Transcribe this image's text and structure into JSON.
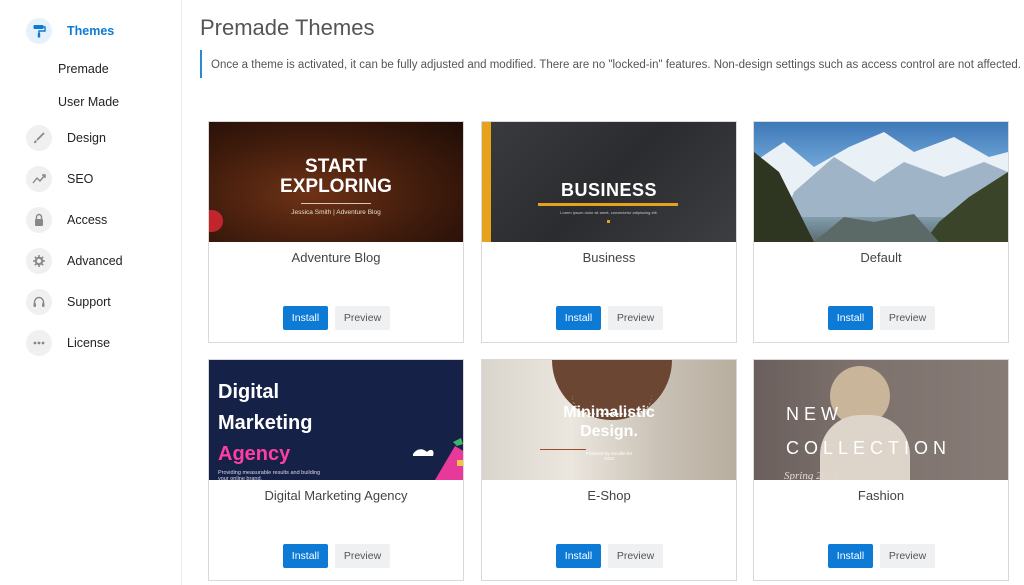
{
  "sidebar": {
    "themes_label": "Themes",
    "sub_items": [
      "Premade",
      "User Made"
    ],
    "items": [
      {
        "label": "Design",
        "icon": "brush-icon"
      },
      {
        "label": "SEO",
        "icon": "trend-icon"
      },
      {
        "label": "Access",
        "icon": "lock-icon"
      },
      {
        "label": "Advanced",
        "icon": "gear-icon"
      },
      {
        "label": "Support",
        "icon": "headset-icon"
      },
      {
        "label": "License",
        "icon": "dots-icon"
      }
    ]
  },
  "main": {
    "title": "Premade Themes",
    "notice": "Once a theme is activated, it can be fully adjusted and modified. There are no \"locked-in\" features. Non-design settings such as access control are not affected."
  },
  "buttons": {
    "install": "Install",
    "preview": "Preview"
  },
  "themes": [
    {
      "name": "Adventure Blog",
      "thumb_line1": "START",
      "thumb_line2": "EXPLORING",
      "thumb_sub": "Jessica Smith | Adventure Blog"
    },
    {
      "name": "Business",
      "thumb_line1": "BUSINESS",
      "thumb_sub": "Lorem ipsum dolor sit amet, consectetur adipiscing elit."
    },
    {
      "name": "Default"
    },
    {
      "name": "Digital Marketing Agency",
      "thumb_line1": "Digital",
      "thumb_line2": "Marketing",
      "thumb_line3": "Agency",
      "thumb_sub": "Providing measurable results and building your online brand."
    },
    {
      "name": "E-Shop",
      "thumb_line1": "Minimalistic",
      "thumb_line2": "Design.",
      "thumb_sub": "Powered by Socalle for 2022"
    },
    {
      "name": "Fashion",
      "thumb_line1": "NEW",
      "thumb_line2": "COLLECTION",
      "thumb_sub": "Spring 2022"
    }
  ],
  "colors": {
    "accent": "#0d7bd6",
    "notice_border": "#2b8ad8",
    "business_bar": "#e5a21a",
    "agency_pink": "#ff3ea5"
  }
}
